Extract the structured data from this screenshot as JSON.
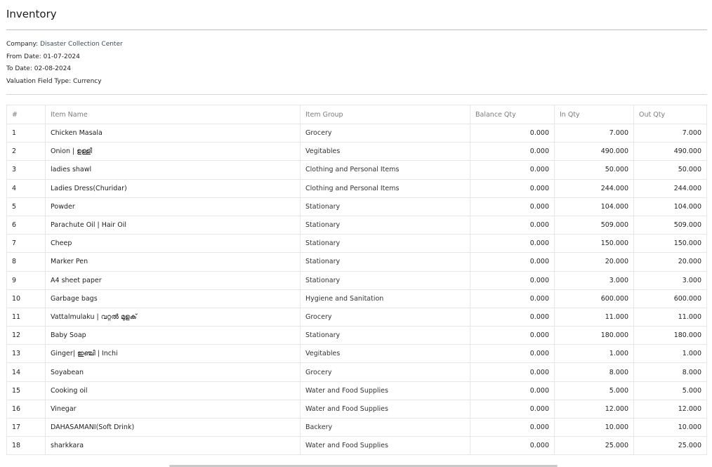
{
  "header": {
    "title": "Inventory"
  },
  "meta": {
    "company_label": "Company:",
    "company_value": "Disaster Collection Center",
    "from_date_label": "From Date:",
    "from_date_value": "01-07-2024",
    "to_date_label": "To Date:",
    "to_date_value": "02-08-2024",
    "valuation_label": "Valuation Field Type:",
    "valuation_value": "Currency"
  },
  "table": {
    "columns": [
      "#",
      "Item Name",
      "Item Group",
      "Balance Qty",
      "In Qty",
      "Out Qty"
    ],
    "rows": [
      {
        "no": "1",
        "item": "Chicken Masala",
        "group": "Grocery",
        "balance": "0.000",
        "in": "7.000",
        "out": "7.000"
      },
      {
        "no": "2",
        "item": "Onion | ഉള്ളി",
        "group": "Vegitables",
        "balance": "0.000",
        "in": "490.000",
        "out": "490.000"
      },
      {
        "no": "3",
        "item": "ladies shawl",
        "group": "Clothing and Personal Items",
        "balance": "0.000",
        "in": "50.000",
        "out": "50.000"
      },
      {
        "no": "4",
        "item": "Ladies Dress(Churidar)",
        "group": "Clothing and Personal Items",
        "balance": "0.000",
        "in": "244.000",
        "out": "244.000"
      },
      {
        "no": "5",
        "item": "Powder",
        "group": "Stationary",
        "balance": "0.000",
        "in": "104.000",
        "out": "104.000"
      },
      {
        "no": "6",
        "item": "Parachute Oil | Hair Oil",
        "group": "Stationary",
        "balance": "0.000",
        "in": "509.000",
        "out": "509.000"
      },
      {
        "no": "7",
        "item": "Cheep",
        "group": "Stationary",
        "balance": "0.000",
        "in": "150.000",
        "out": "150.000"
      },
      {
        "no": "8",
        "item": "Marker Pen",
        "group": "Stationary",
        "balance": "0.000",
        "in": "20.000",
        "out": "20.000"
      },
      {
        "no": "9",
        "item": "A4 sheet paper",
        "group": "Stationary",
        "balance": "0.000",
        "in": "3.000",
        "out": "3.000"
      },
      {
        "no": "10",
        "item": "Garbage bags",
        "group": "Hygiene and Sanitation",
        "balance": "0.000",
        "in": "600.000",
        "out": "600.000"
      },
      {
        "no": "11",
        "item": "Vattalmulaku | വറ്റൽ മുളക്",
        "group": "Grocery",
        "balance": "0.000",
        "in": "11.000",
        "out": "11.000"
      },
      {
        "no": "12",
        "item": "Baby Soap",
        "group": "Stationary",
        "balance": "0.000",
        "in": "180.000",
        "out": "180.000"
      },
      {
        "no": "13",
        "item": "Ginger| ഇഞ്ചി | Inchi",
        "group": "Vegitables",
        "balance": "0.000",
        "in": "1.000",
        "out": "1.000"
      },
      {
        "no": "14",
        "item": "Soyabean",
        "group": "Grocery",
        "balance": "0.000",
        "in": "8.000",
        "out": "8.000"
      },
      {
        "no": "15",
        "item": "Cooking oil",
        "group": "Water and Food Supplies",
        "balance": "0.000",
        "in": "5.000",
        "out": "5.000"
      },
      {
        "no": "16",
        "item": "Vinegar",
        "group": "Water and Food Supplies",
        "balance": "0.000",
        "in": "12.000",
        "out": "12.000"
      },
      {
        "no": "17",
        "item": "DAHASAMANI(Soft Drink)",
        "group": "Backery",
        "balance": "0.000",
        "in": "10.000",
        "out": "10.000"
      },
      {
        "no": "18",
        "item": "sharkkara",
        "group": "Water and Food Supplies",
        "balance": "0.000",
        "in": "25.000",
        "out": "25.000"
      }
    ]
  }
}
